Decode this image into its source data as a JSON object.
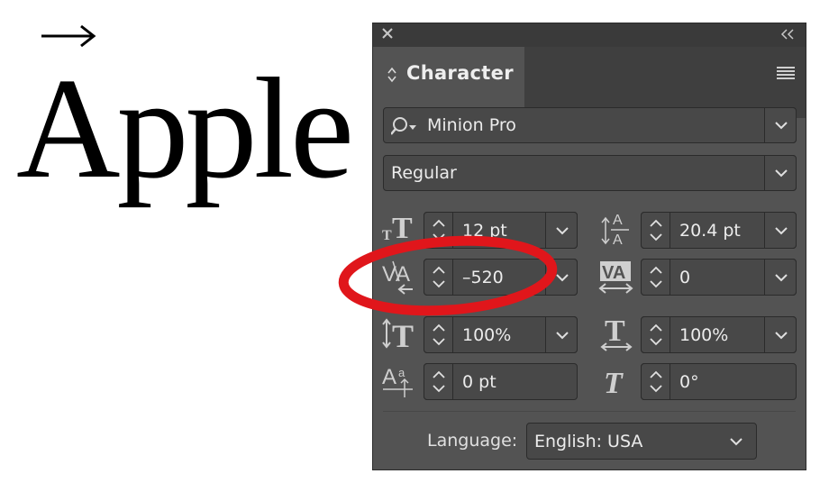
{
  "sample": {
    "text": "Apple"
  },
  "panel": {
    "title": "Character",
    "font_family": "Minion Pro",
    "font_style": "Regular",
    "font_size": "12 pt",
    "leading": "20.4 pt",
    "kerning": "–520",
    "tracking": "0",
    "vertical_scale": "100%",
    "horizontal_scale": "100%",
    "baseline_shift": "0 pt",
    "skew": "0°",
    "language_label": "Language:",
    "language": "English: USA"
  },
  "icons": {
    "close": "close-icon",
    "collapse": "double-chevron-left-icon",
    "menu": "hamburger-menu-icon",
    "search": "search-icon",
    "font_size": "font-size-icon",
    "leading": "leading-icon",
    "kerning": "kerning-icon",
    "tracking": "tracking-icon",
    "vertical_scale": "vertical-scale-icon",
    "horizontal_scale": "horizontal-scale-icon",
    "baseline_shift": "baseline-shift-icon",
    "skew": "skew-icon"
  },
  "colors": {
    "panel_bg": "#535353",
    "field_bg": "#484848",
    "highlight": "#e0161b"
  }
}
